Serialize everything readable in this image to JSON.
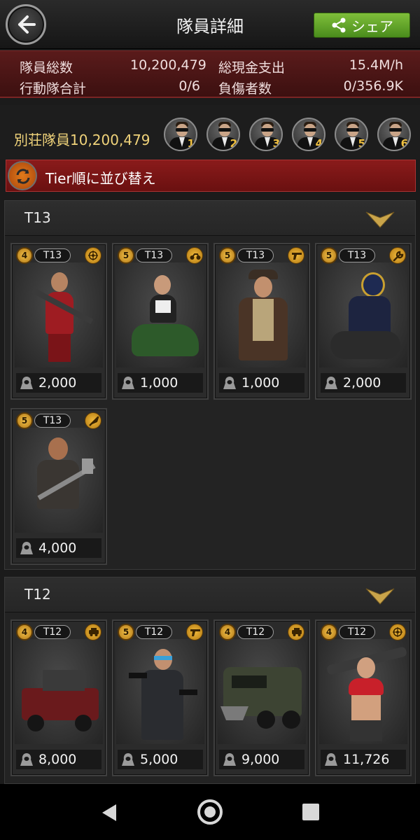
{
  "header": {
    "title": "隊員詳細",
    "share_label": "シェア"
  },
  "stats": {
    "total_members_label": "隊員総数",
    "total_members_value": "10,200,479",
    "cash_label": "総現金支出",
    "cash_value": "15.4M/h",
    "squads_label": "行動隊合計",
    "squads_value": "0/6",
    "injured_label": "負傷者数",
    "injured_value": "0/356.9K"
  },
  "villa": {
    "label": "別荘隊員",
    "count": "10,200,479",
    "agents": [
      "1",
      "2",
      "3",
      "4",
      "5",
      "6"
    ]
  },
  "sort": {
    "label": "Tier順に並び替え"
  },
  "tiers": [
    {
      "title": "T13",
      "cards": [
        {
          "stars": "4",
          "tier": "T13",
          "role": "target-icon",
          "power": "2,000"
        },
        {
          "stars": "5",
          "tier": "T13",
          "role": "motorcycle-icon",
          "power": "1,000"
        },
        {
          "stars": "5",
          "tier": "T13",
          "role": "gun-icon",
          "power": "1,000"
        },
        {
          "stars": "5",
          "tier": "T13",
          "role": "wrench-icon",
          "power": "2,000"
        },
        {
          "stars": "5",
          "tier": "T13",
          "role": "knife-icon",
          "power": "4,000"
        }
      ]
    },
    {
      "title": "T12",
      "cards": [
        {
          "stars": "4",
          "tier": "T12",
          "role": "vehicle-icon",
          "power": "8,000"
        },
        {
          "stars": "5",
          "tier": "T12",
          "role": "gun-icon",
          "power": "5,000"
        },
        {
          "stars": "4",
          "tier": "T12",
          "role": "vehicle-icon",
          "power": "9,000"
        },
        {
          "stars": "4",
          "tier": "T12",
          "role": "target-icon",
          "power": "11,726"
        }
      ]
    }
  ],
  "colors": {
    "accent_gold": "#f0c040",
    "stats_red": "#5a1b1b",
    "share_green": "#6aa82c"
  }
}
